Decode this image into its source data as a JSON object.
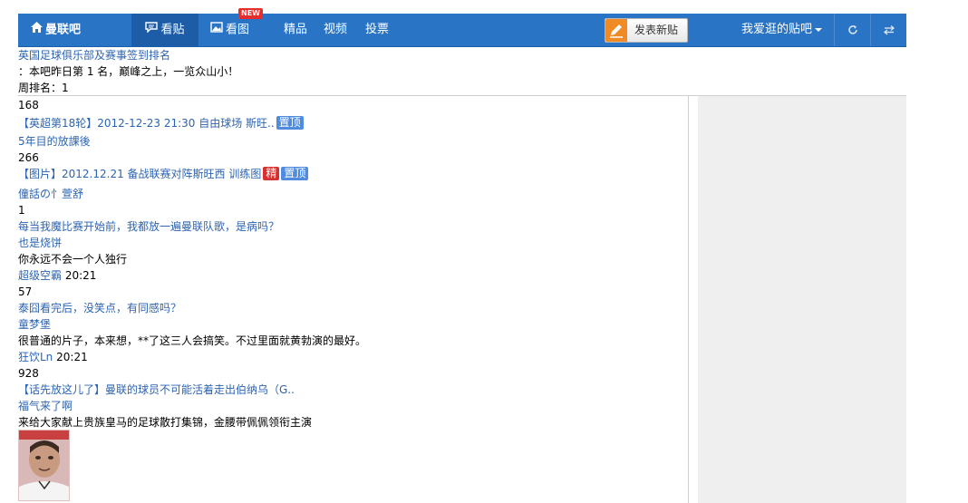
{
  "nav": {
    "home": "曼联吧",
    "view_posts": "看贴",
    "view_images": "看图",
    "new_badge": "NEW",
    "featured": "精品",
    "videos": "视频",
    "polls": "投票",
    "post_button": "发表新贴",
    "favorite_bars": "我爱逛的贴吧",
    "accent_color": "#2a74c6"
  },
  "header": {
    "ranking_link": "英国足球俱乐部及赛事签到排名",
    "yesterday_rank": "：本吧昨日第 1 名，巅峰之上，一览众山小！",
    "weekly_rank": "周排名：1"
  },
  "threads": [
    {
      "count": "168"
    },
    {
      "title": "【英超第18轮】2012-12-23 21:30 自由球场 斯旺..",
      "tags": [
        "置顶"
      ],
      "author": "5年目的放課後"
    },
    {
      "count": "266"
    },
    {
      "title": "【图片】2012.12.21 备战联赛对阵斯旺西 训练图",
      "tags": [
        "精",
        "置顶"
      ],
      "author": "僮話の忄萱舒"
    },
    {
      "count": "1"
    },
    {
      "title": "每当我魔比赛开始前，我都放一遍曼联队歌，是病吗？",
      "author": "也是烧饼",
      "preview": "你永远不会一个人独行",
      "last_reply_user": "超级空霸",
      "last_reply_time": "20:21"
    },
    {
      "count": "57"
    },
    {
      "title": "泰囧看完后，没笑点，有同感吗？",
      "author": "童梦堡",
      "preview": "很普通的片子，本来想，**了这三人会搞笑。不过里面就黄勃演的最好。",
      "last_reply_user": "狂饮Ln",
      "last_reply_time": "20:21"
    },
    {
      "count": "928"
    },
    {
      "title": "【话先放这儿了】曼联的球员不可能活着走出伯纳乌（G..",
      "author": "福气来了啊",
      "preview": "来给大家献上贵族皇马的足球散打集锦，金腰带佩佩领衔主演"
    }
  ]
}
